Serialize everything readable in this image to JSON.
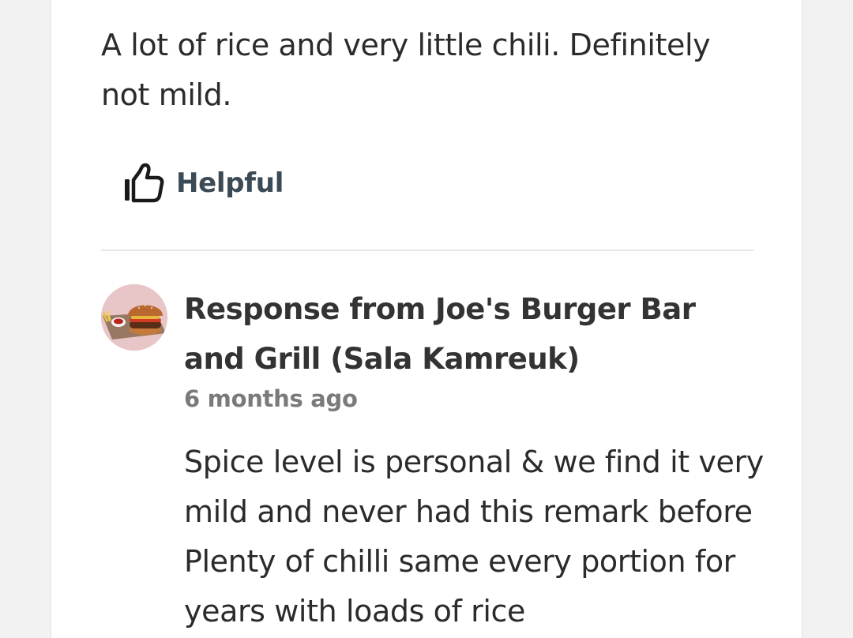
{
  "review": {
    "text": "A lot of rice and very little chili. Definitely not mild.",
    "helpful_label": "Helpful"
  },
  "response": {
    "title": "Response from Joe's Burger Bar and Grill (Sala Kamreuk)",
    "time": "6 months ago",
    "text": "Spice level is personal & we find it very mild and never had this remark before Plenty of chilli same every portion for years with loads of rice"
  },
  "icons": {
    "helpful": "thumbs-up-icon"
  },
  "colors": {
    "background": "#f2f2f2",
    "card": "#ffffff",
    "text": "#2b2b2b",
    "helpful": "#3b4a55",
    "muted": "#7a7a7a"
  }
}
